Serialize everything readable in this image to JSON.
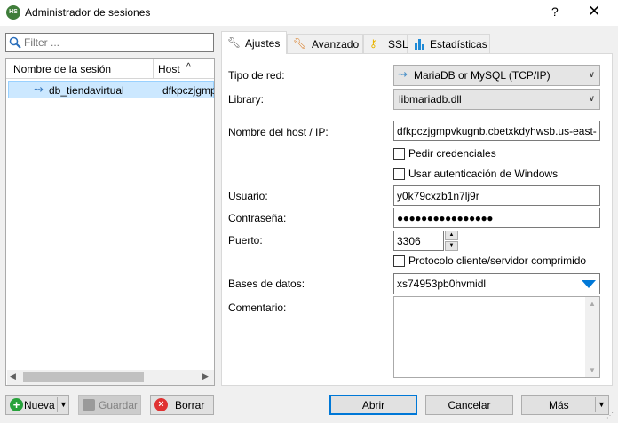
{
  "window": {
    "app_icon_text": "HS",
    "title": "Administrador de sesiones",
    "help_label": "?",
    "close_label": "✕"
  },
  "filter": {
    "placeholder": "Filter ..."
  },
  "session_list": {
    "columns": [
      "Nombre de la sesión",
      "Host"
    ],
    "sort_indicator": "^",
    "rows": [
      {
        "name": "db_tiendavirtual",
        "host": "dfkpczjgmpvkugnb.cbetxkdyhwsb.us-east-",
        "selected": true
      }
    ]
  },
  "left_buttons": {
    "new": "Nueva",
    "save": "Guardar",
    "delete": "Borrar"
  },
  "tabs": [
    {
      "label": "Ajustes",
      "icon": "wrench-icon",
      "active": true
    },
    {
      "label": "Avanzado",
      "icon": "wrench-orange-icon",
      "active": false
    },
    {
      "label": "SSL",
      "icon": "key-icon",
      "active": false
    },
    {
      "label": "Estadísticas",
      "icon": "bar-chart-icon",
      "active": false
    }
  ],
  "settings": {
    "network_type_label": "Tipo de red:",
    "network_type_value": "MariaDB or MySQL (TCP/IP)",
    "library_label": "Library:",
    "library_value": "libmariadb.dll",
    "host_label": "Nombre del host / IP:",
    "host_value": "dfkpczjgmpvkugnb.cbetxkdyhwsb.us-east-",
    "ask_credentials_label": "Pedir credenciales",
    "ask_credentials_checked": false,
    "windows_auth_label": "Usar autenticación de Windows",
    "windows_auth_checked": false,
    "user_label": "Usuario:",
    "user_value": "y0k79cxzb1n7lj9r",
    "password_label": "Contraseña:",
    "password_value": "●●●●●●●●●●●●●●●●",
    "port_label": "Puerto:",
    "port_value": "3306",
    "compressed_label": "Protocolo cliente/servidor comprimido",
    "compressed_checked": false,
    "databases_label": "Bases de datos:",
    "databases_value": "xs74953pb0hvmidl",
    "comment_label": "Comentario:",
    "comment_value": ""
  },
  "dialog_buttons": {
    "open": "Abrir",
    "cancel": "Cancelar",
    "more": "Más"
  },
  "colors": {
    "accent": "#0078d7",
    "selection": "#cce8ff",
    "new_icon": "#27a23b",
    "delete_icon": "#e03131"
  }
}
